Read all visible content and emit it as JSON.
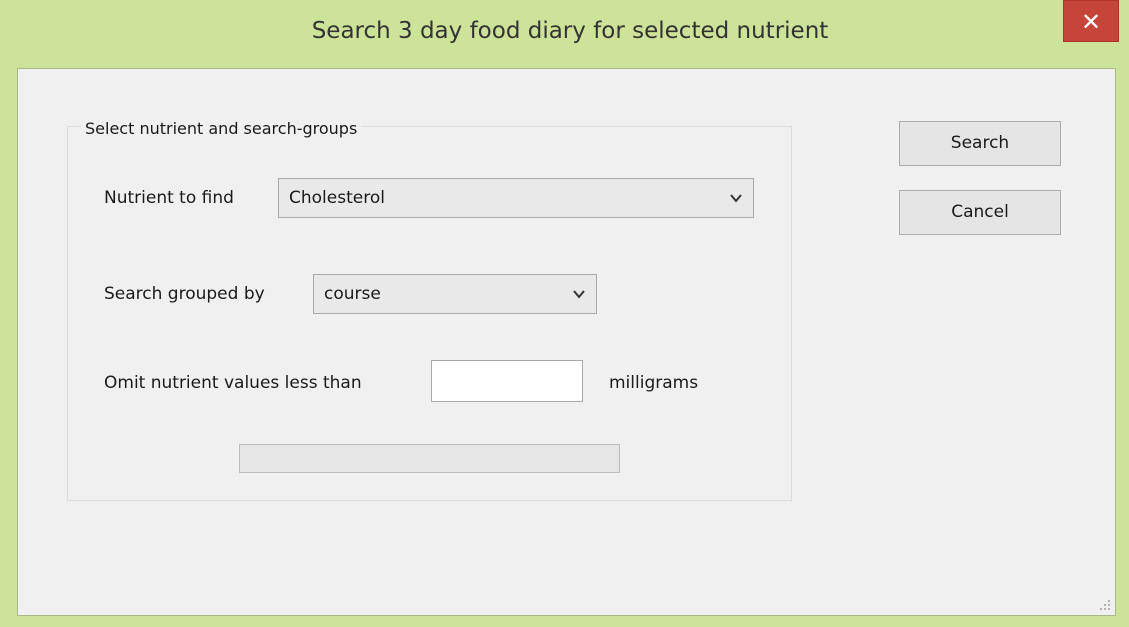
{
  "window": {
    "title": "Search 3 day food diary for selected nutrient",
    "close_glyph": "✕",
    "frame_color": "#cde39a",
    "close_color": "#c7443b"
  },
  "group": {
    "legend": "Select nutrient and search-groups"
  },
  "nutrient": {
    "label": "Nutrient to find",
    "selected": "Cholesterol"
  },
  "grouping": {
    "label": "Search grouped by",
    "selected": "course"
  },
  "threshold": {
    "label": "Omit nutrient values less than",
    "value": "",
    "unit": "milligrams"
  },
  "progress": {
    "fraction": 0
  },
  "buttons": {
    "search": "Search",
    "cancel": "Cancel"
  },
  "icons": {
    "close": "close-icon",
    "dropdown": "chevron-down-icon",
    "resize": "resize-grip-icon"
  }
}
